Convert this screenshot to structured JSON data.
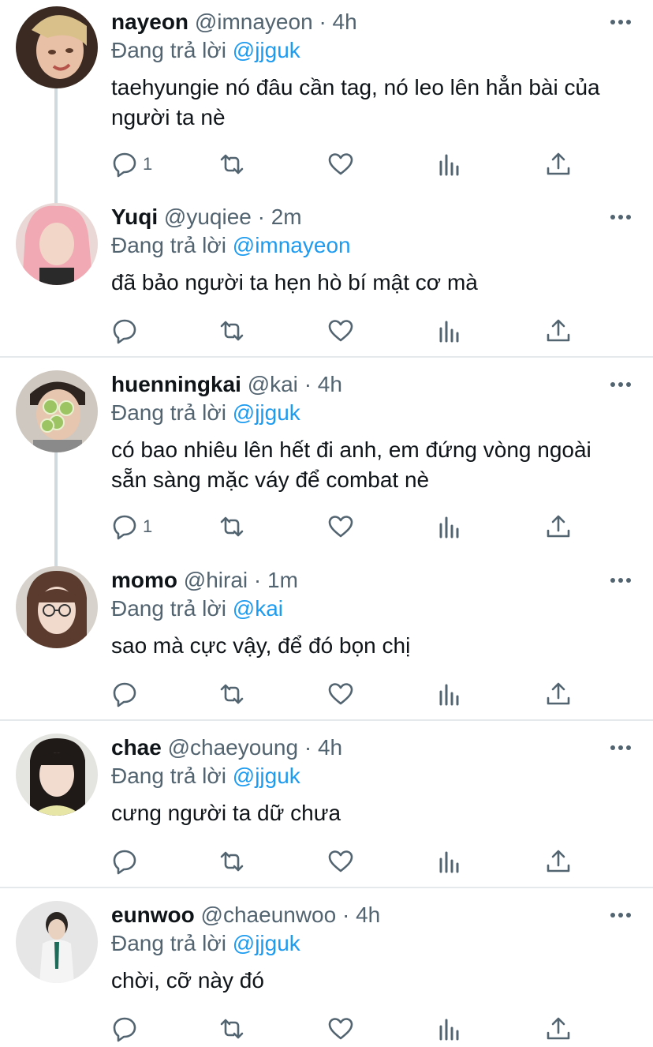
{
  "reply_prefix": "Đang trả lời",
  "tweets": [
    {
      "name": "nayeon",
      "handle": "@imnayeon",
      "dot": "·",
      "time": "4h",
      "reply_to": "@jjguk",
      "text": "taehyungie nó đâu cần tag, nó leo lên hẳn bài của người ta nè",
      "reply_count": "1"
    },
    {
      "name": "Yuqi",
      "handle": "@yuqiee",
      "dot": "·",
      "time": "2m",
      "reply_to": "@imnayeon",
      "text": "đã bảo người ta hẹn hò bí mật cơ mà",
      "reply_count": ""
    },
    {
      "name": "huenningkai",
      "handle": "@kai",
      "dot": "·",
      "time": "4h",
      "reply_to": "@jjguk",
      "text": "có bao nhiêu lên hết đi anh, em đứng vòng ngoài sẵn sàng mặc váy để combat nè",
      "reply_count": "1"
    },
    {
      "name": "momo",
      "handle": "@hirai",
      "dot": "·",
      "time": "1m",
      "reply_to": "@kai",
      "text": "sao mà cực vậy, để đó bọn chị",
      "reply_count": ""
    },
    {
      "name": "chae",
      "handle": "@chaeyoung",
      "dot": "·",
      "time": "4h",
      "reply_to": "@jjguk",
      "text": "cưng người ta dữ chưa",
      "reply_count": ""
    },
    {
      "name": "eunwoo",
      "handle": "@chaeunwoo",
      "dot": "·",
      "time": "4h",
      "reply_to": "@jjguk",
      "text": "chời, cỡ này đó",
      "reply_count": ""
    }
  ],
  "icons": {
    "reply": "reply-icon",
    "retweet": "retweet-icon",
    "like": "heart-icon",
    "views": "analytics-icon",
    "share": "share-icon",
    "more": "more-icon"
  },
  "colors": {
    "text": "#0f1419",
    "secondary": "#536471",
    "mention": "#1d9bf0",
    "thread_line": "#cfd9de",
    "divider": "#e6e9eb"
  }
}
